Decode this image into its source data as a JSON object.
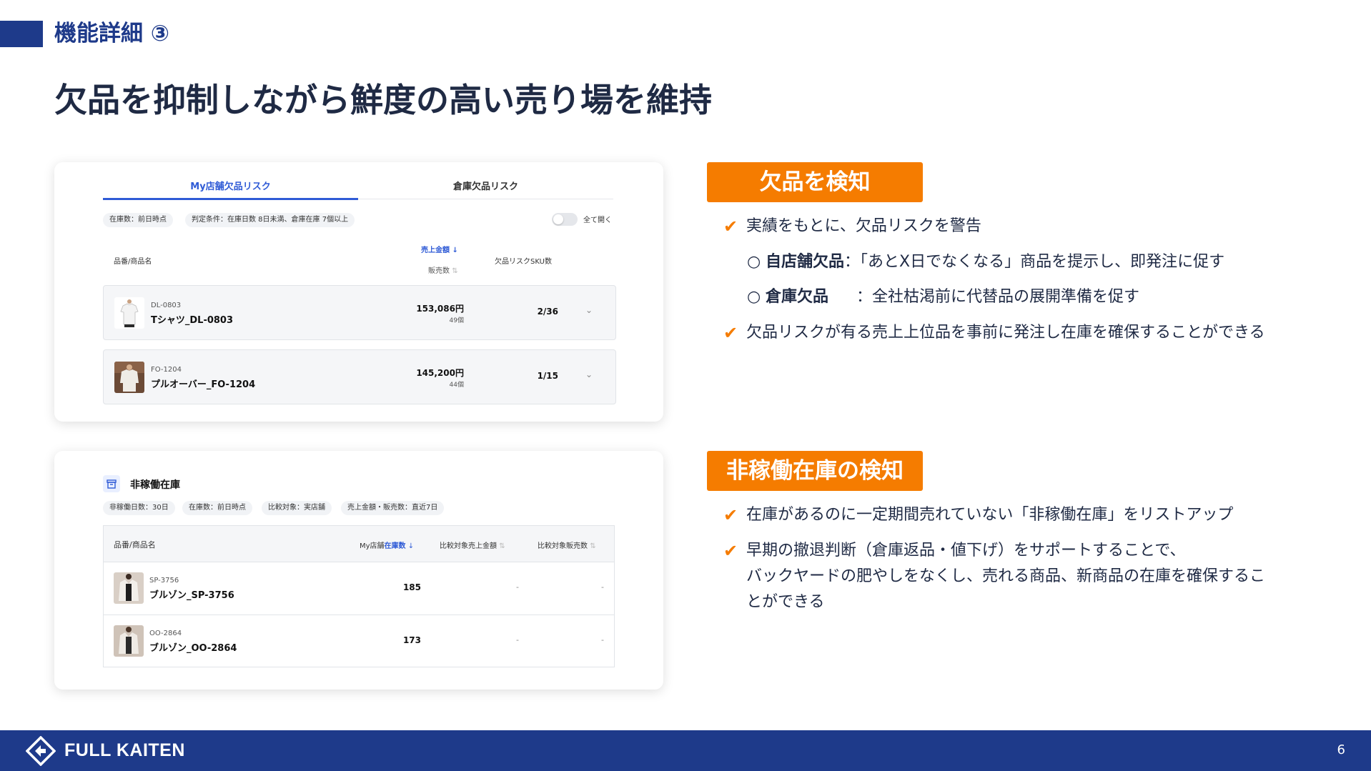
{
  "header": {
    "section_label": "機能詳細 ③",
    "title": "欠品を抑制しながら鮮度の高い売り場を維持"
  },
  "stockout_panel": {
    "tabs": [
      "My店舗欠品リスク",
      "倉庫欠品リスク"
    ],
    "active_tab": 0,
    "chips": [
      "在庫数：前日時点",
      "判定条件：在庫日数 8日未満、倉庫在庫 7個以上"
    ],
    "toggle_label": "全て開く",
    "columns": {
      "product": "品番/商品名",
      "sales_amount": "売上金額",
      "sales_qty": "販売数",
      "risk_sku": "欠品リスクSKU数"
    },
    "rows": [
      {
        "sku": "DL-0803",
        "name": "Tシャツ_DL-0803",
        "amount": "153,086円",
        "qty": "49個",
        "ratio": "2/36"
      },
      {
        "sku": "FO-1204",
        "name": "プルオーバー_FO-1204",
        "amount": "145,200円",
        "qty": "44個",
        "ratio": "1/15"
      }
    ]
  },
  "idle_panel": {
    "title": "非稼働在庫",
    "chips": [
      "非稼働日数：30日",
      "在庫数：前日時点",
      "比較対象：実店舗",
      "売上金額・販売数：直近7日"
    ],
    "columns": {
      "product": "品番/商品名",
      "my_stock_prefix": "My店舗",
      "my_stock": "在庫数",
      "cmp_amount": "比較対象売上金額",
      "cmp_qty": "比較対象販売数"
    },
    "rows": [
      {
        "sku": "SP-3756",
        "name": "ブルゾン_SP-3756",
        "stock": "185",
        "cmp_amount": "-",
        "cmp_qty": "-"
      },
      {
        "sku": "OO-2864",
        "name": "ブルゾン_OO-2864",
        "stock": "173",
        "cmp_amount": "-",
        "cmp_qty": "-"
      }
    ]
  },
  "feature1": {
    "badge": "欠品を検知",
    "b1": "実績をもとに、欠品リスクを警告",
    "s1_label": "自店舗欠品",
    "s1_text": "：「あとX日でなくなる」商品を提示し、即発注に促す",
    "s2_label": "倉庫欠品",
    "s2_text": "：全社枯渇前に代替品の展開準備を促す",
    "b2": "欠品リスクが有る売上上位品を事前に発注し在庫を確保することができる"
  },
  "feature2": {
    "badge": "非稼働在庫の検知",
    "b1": "在庫があるのに一定期間売れていない「非稼働在庫」をリストアップ",
    "b2_line1": "早期の撤退判断（倉庫返品・値下げ）をサポートすることで、",
    "b2_line2": "バックヤードの肥やしをなくし、売れる商品、新商品の在庫を確保するこ",
    "b2_line3": "とができる"
  },
  "icons": {
    "check": "✔",
    "sub_bullet": "○",
    "chevron": "⌄",
    "sort_down": "↓",
    "sort_neutral": "⇅"
  },
  "footer": {
    "brand": "FULL KAITEN",
    "page": "6"
  },
  "colors": {
    "navy": "#1e3a8a",
    "accent_orange": "#f57c00",
    "link_blue": "#2f5bd6"
  }
}
